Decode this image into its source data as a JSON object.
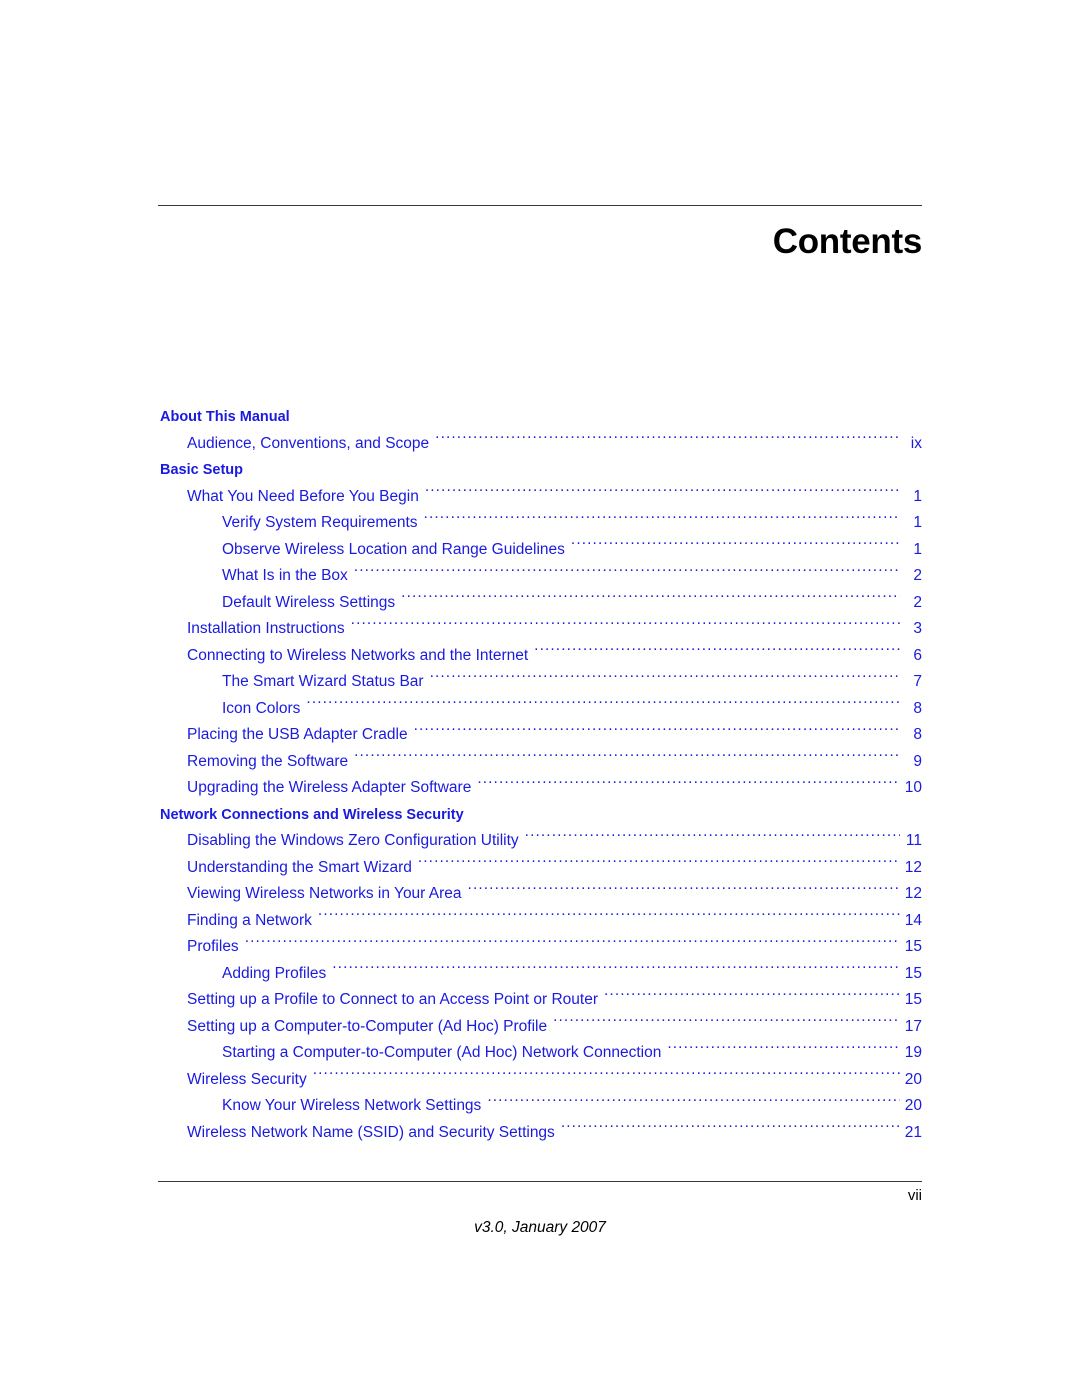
{
  "header": {
    "title": "Contents"
  },
  "toc": {
    "blocks": [
      {
        "type": "chapter",
        "label": "About This Manual"
      },
      {
        "type": "entry",
        "level": 1,
        "label": "Audience, Conventions, and Scope",
        "page": "ix"
      },
      {
        "type": "chapter",
        "label": "Basic Setup"
      },
      {
        "type": "entry",
        "level": 1,
        "label": "What You Need Before You Begin",
        "page": "1"
      },
      {
        "type": "entry",
        "level": 2,
        "label": "Verify System Requirements",
        "page": "1"
      },
      {
        "type": "entry",
        "level": 2,
        "label": "Observe Wireless Location and Range Guidelines",
        "page": "1"
      },
      {
        "type": "entry",
        "level": 2,
        "label": "What Is in the Box",
        "page": "2"
      },
      {
        "type": "entry",
        "level": 2,
        "label": "Default Wireless Settings",
        "page": "2"
      },
      {
        "type": "entry",
        "level": 1,
        "label": "Installation Instructions",
        "page": "3"
      },
      {
        "type": "entry",
        "level": 1,
        "label": "Connecting to Wireless Networks and the Internet",
        "page": "6"
      },
      {
        "type": "entry",
        "level": 2,
        "label": "The Smart Wizard Status Bar",
        "page": "7"
      },
      {
        "type": "entry",
        "level": 2,
        "label": "Icon Colors",
        "page": "8"
      },
      {
        "type": "entry",
        "level": 1,
        "label": "Placing the USB Adapter Cradle",
        "page": "8"
      },
      {
        "type": "entry",
        "level": 1,
        "label": "Removing the Software",
        "page": "9"
      },
      {
        "type": "entry",
        "level": 1,
        "label": "Upgrading the Wireless Adapter Software",
        "page": "10"
      },
      {
        "type": "chapter",
        "label": "Network Connections and Wireless Security"
      },
      {
        "type": "entry",
        "level": 1,
        "label": "Disabling the Windows Zero Configuration Utility",
        "page": "11"
      },
      {
        "type": "entry",
        "level": 1,
        "label": "Understanding the Smart Wizard",
        "page": "12"
      },
      {
        "type": "entry",
        "level": 1,
        "label": "Viewing Wireless Networks in Your Area",
        "page": "12"
      },
      {
        "type": "entry",
        "level": 1,
        "label": "Finding a Network",
        "page": "14"
      },
      {
        "type": "entry",
        "level": 1,
        "label": "Profiles",
        "page": "15"
      },
      {
        "type": "entry",
        "level": 2,
        "label": "Adding Profiles",
        "page": "15"
      },
      {
        "type": "entry",
        "level": 1,
        "label": "Setting up a Profile to Connect to an Access Point or Router",
        "page": "15"
      },
      {
        "type": "entry",
        "level": 1,
        "label": "Setting up a Computer-to-Computer (Ad Hoc) Profile",
        "page": "17"
      },
      {
        "type": "entry",
        "level": 2,
        "label": "Starting a Computer-to-Computer (Ad Hoc) Network Connection",
        "page": "19"
      },
      {
        "type": "entry",
        "level": 1,
        "label": "Wireless Security",
        "page": "20"
      },
      {
        "type": "entry",
        "level": 2,
        "label": "Know Your Wireless Network Settings",
        "page": "20"
      },
      {
        "type": "entry",
        "level": 1,
        "label": "Wireless Network Name (SSID) and Security Settings",
        "page": "21"
      }
    ]
  },
  "footer": {
    "folio": "vii",
    "version": "v3.0, January 2007"
  },
  "colors": {
    "link_blue": "#1a1ae0",
    "rule_gray": "#3a3a3a",
    "text_black": "#000000"
  }
}
